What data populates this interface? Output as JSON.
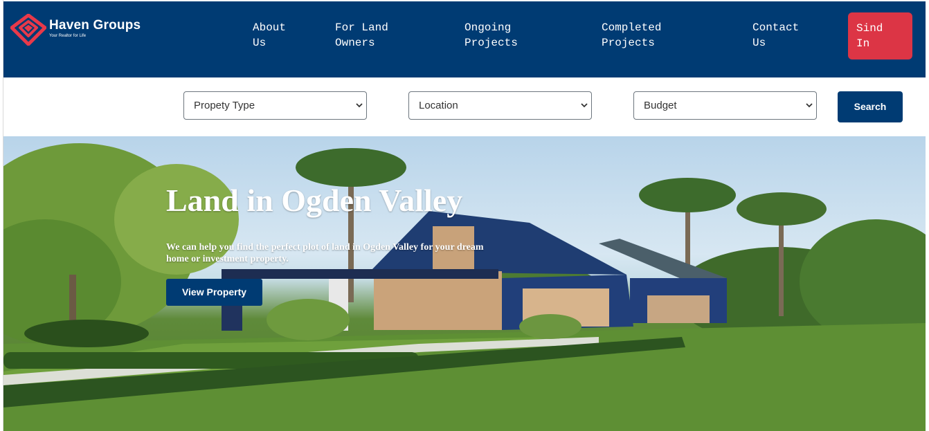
{
  "brand": {
    "name": "Haven Groups",
    "tagline": "Your Realtor for Life",
    "logo_icon": "diamond-heart-logo",
    "color_primary": "#003b73",
    "color_accent": "#dc3545"
  },
  "nav": {
    "items": [
      {
        "line1": "About",
        "line2": "Us"
      },
      {
        "line1": "For Land",
        "line2": "Owners"
      },
      {
        "line1": "Ongoing",
        "line2": "Projects"
      },
      {
        "line1": "Completed",
        "line2": "Projects"
      },
      {
        "line1": "Contact",
        "line2": "Us"
      }
    ],
    "signin": {
      "line1": "Sind",
      "line2": "In"
    }
  },
  "search": {
    "property_type": "Propety Type",
    "location": "Location",
    "budget": "Budget",
    "button": "Search",
    "chevron_icon": "chevron-down-icon"
  },
  "hero": {
    "title": "Land in Ogden Valley",
    "subtitle": "We can help you find the perfect plot of land in Ogden Valley for your dream home or investment property.",
    "button": "View Property"
  }
}
